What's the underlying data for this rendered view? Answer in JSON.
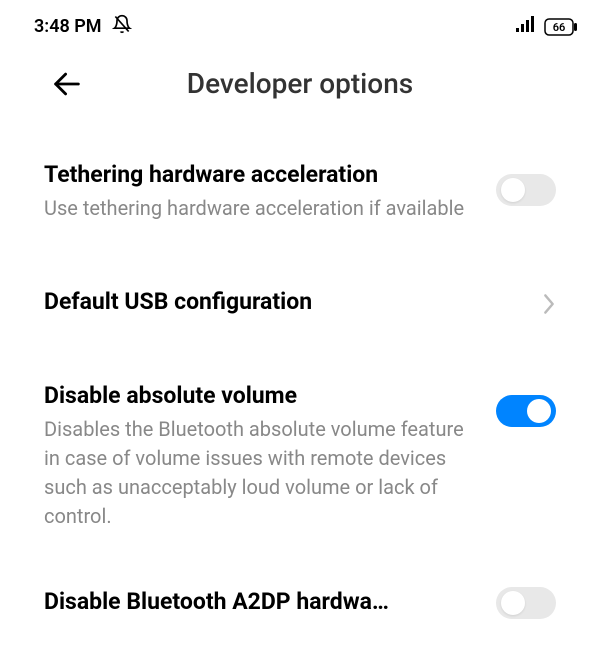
{
  "statusBar": {
    "time": "3:48 PM",
    "battery": "66"
  },
  "header": {
    "title": "Developer options"
  },
  "settings": {
    "tethering": {
      "title": "Tethering hardware acceleration",
      "subtitle": "Use tethering hardware acceleration if available",
      "enabled": false
    },
    "usb": {
      "title": "Default USB configuration"
    },
    "absoluteVolume": {
      "title": "Disable absolute volume",
      "subtitle": "Disables the Bluetooth absolute volume feature in case of volume issues with remote devices such as unacceptably loud volume or lack of control.",
      "enabled": true
    },
    "a2dp": {
      "title": "Disable Bluetooth A2DP hardwa…",
      "enabled": false
    }
  }
}
